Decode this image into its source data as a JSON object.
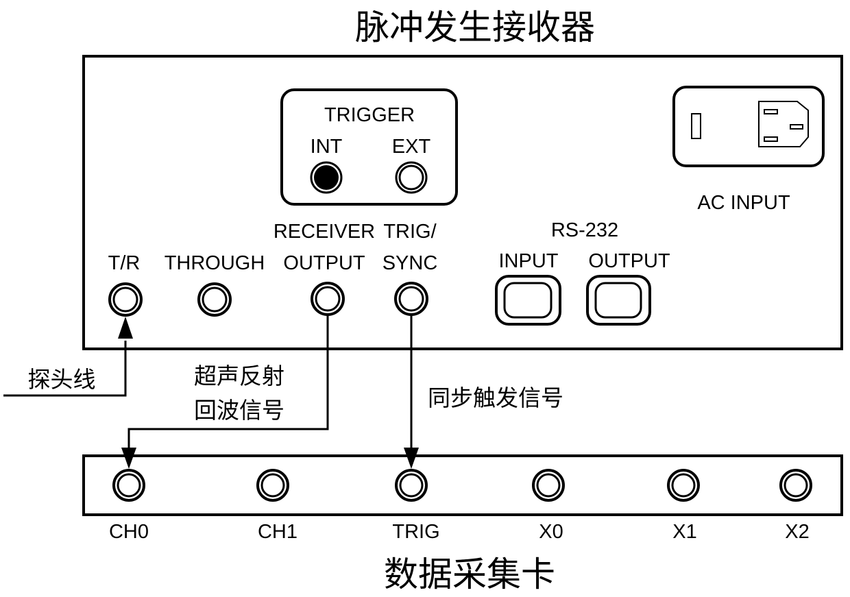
{
  "diagram": {
    "title_top": "脉冲发生接收器",
    "title_bottom": "数据采集卡",
    "pulser_receiver": {
      "trigger_panel": {
        "title": "TRIGGER",
        "int_label": "INT",
        "ext_label": "EXT",
        "selected": "INT"
      },
      "ac_input_label": "AC INPUT",
      "rs232": {
        "title": "RS-232",
        "input_label": "INPUT",
        "output_label": "OUTPUT"
      },
      "ports": [
        {
          "id": "tr",
          "label_line1": "",
          "label_line2": "T/R"
        },
        {
          "id": "through",
          "label_line1": "",
          "label_line2": "THROUGH"
        },
        {
          "id": "receiver-output",
          "label_line1": "RECEIVER",
          "label_line2": "OUTPUT"
        },
        {
          "id": "trig-sync",
          "label_line1": "TRIG/",
          "label_line2": "SYNC"
        }
      ]
    },
    "daq_card": {
      "ports": [
        {
          "id": "ch0",
          "label": "CH0"
        },
        {
          "id": "ch1",
          "label": "CH1"
        },
        {
          "id": "trig",
          "label": "TRIG"
        },
        {
          "id": "x0",
          "label": "X0"
        },
        {
          "id": "x1",
          "label": "X1"
        },
        {
          "id": "x2",
          "label": "X2"
        }
      ]
    },
    "connections": [
      {
        "from": "probe-cable",
        "to": "T/R",
        "label": "探头线"
      },
      {
        "from": "RECEIVER OUTPUT",
        "to": "CH0",
        "label_line1": "超声反射",
        "label_line2": "回波信号"
      },
      {
        "from": "TRIG/SYNC",
        "to": "TRIG",
        "label": "同步触发信号"
      }
    ]
  }
}
